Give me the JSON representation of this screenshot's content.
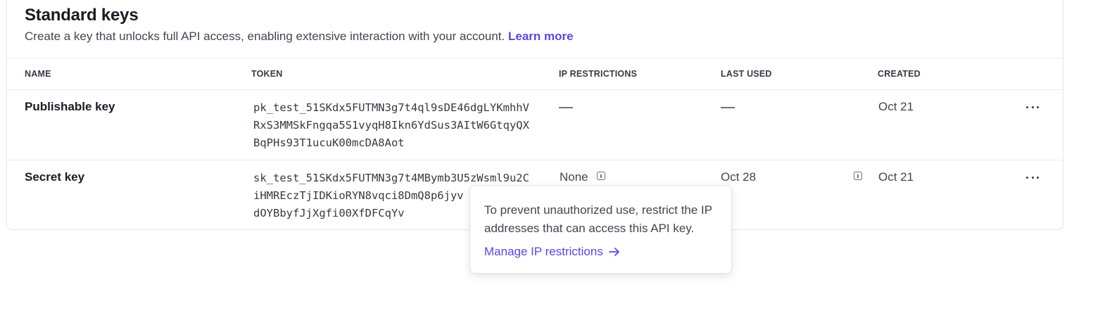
{
  "section": {
    "title": "Standard keys",
    "subtitle": "Create a key that unlocks full API access, enabling extensive interaction with your account.",
    "learn_more": "Learn more"
  },
  "columns": {
    "name": "NAME",
    "token": "TOKEN",
    "ip_restrictions": "IP RESTRICTIONS",
    "last_used": "LAST USED",
    "created": "CREATED"
  },
  "rows": [
    {
      "name": "Publishable key",
      "token_lines": [
        "pk_test_51SKdx5FUTMN3g7t4ql9sDE46dgLYKmhhV",
        "RxS3MMSkFngqa5S1vyqH8Ikn6YdSus3AItW6GtqyQX",
        "BqPHs93T1ucuK00mcDA8Aot"
      ],
      "ip_restrictions": "—",
      "last_used": "—",
      "created": "Oct 21"
    },
    {
      "name": "Secret key",
      "token_lines": [
        "sk_test_51SKdx5FUTMN3g7t4MBymb3U5zWsml9u2C",
        "iHMREczTjIDKioRYN8vqci8DmQ8p6jyv",
        "dOYBbyfJjXgfi00XfDFCqYv"
      ],
      "ip_restrictions": "None",
      "last_used": "Oct 28",
      "created": "Oct 21"
    }
  ],
  "tooltip": {
    "text": "To prevent unauthorized use, restrict the IP addresses that can access this API key.",
    "link": "Manage IP restrictions"
  },
  "colors": {
    "accent": "#5b46e8",
    "text": "#1a1b25",
    "muted": "#414552",
    "border": "#ebedf1"
  },
  "icons": [
    "info-icon",
    "more-options-icon",
    "arrow-right-icon"
  ]
}
